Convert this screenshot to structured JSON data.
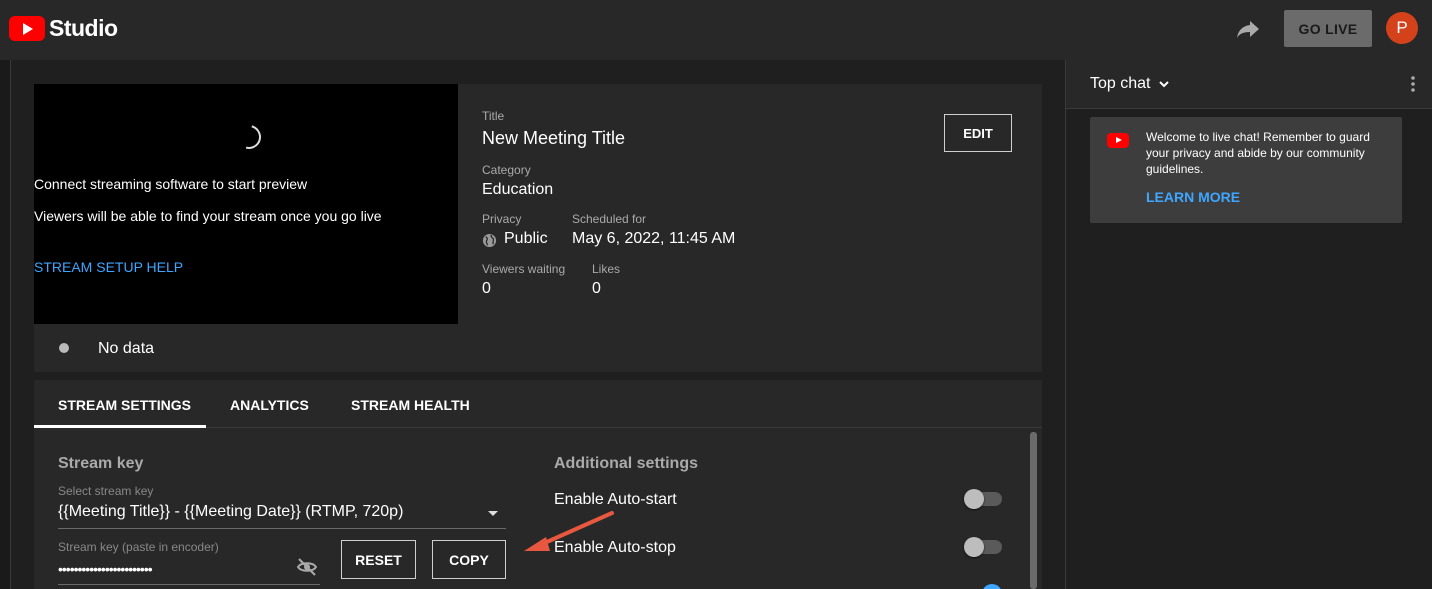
{
  "header": {
    "app_name": "Studio",
    "go_live_label": "GO LIVE",
    "avatar_initial": "P"
  },
  "preview": {
    "message_primary": "Connect streaming software to start preview",
    "message_secondary": "Viewers will be able to find your stream once you go live",
    "setup_help_label": "STREAM SETUP HELP"
  },
  "details": {
    "title_label": "Title",
    "title_value": "New Meeting Title",
    "category_label": "Category",
    "category_value": "Education",
    "privacy_label": "Privacy",
    "privacy_value": "Public",
    "scheduled_label": "Scheduled for",
    "scheduled_value": "May 6, 2022, 11:45 AM",
    "viewers_label": "Viewers waiting",
    "viewers_value": "0",
    "likes_label": "Likes",
    "likes_value": "0",
    "edit_label": "EDIT"
  },
  "status": {
    "text": "No data"
  },
  "tabs": [
    {
      "label": "STREAM SETTINGS",
      "active": true
    },
    {
      "label": "ANALYTICS",
      "active": false
    },
    {
      "label": "STREAM HEALTH",
      "active": false
    }
  ],
  "stream_key": {
    "section_title": "Stream key",
    "select_label": "Select stream key",
    "select_value": "{{Meeting Title}} - {{Meeting Date}} (RTMP, 720p)",
    "key_label": "Stream key (paste in encoder)",
    "key_value": "••••••••••••••••••••••••",
    "reset_label": "RESET",
    "copy_label": "COPY"
  },
  "additional": {
    "section_title": "Additional settings",
    "auto_start_label": "Enable Auto-start",
    "auto_start_on": false,
    "auto_stop_label": "Enable Auto-stop",
    "auto_stop_on": false
  },
  "chat": {
    "title": "Top chat",
    "welcome": "Welcome to live chat! Remember to guard your privacy and abide by our community guidelines.",
    "learn_more_label": "LEARN MORE"
  },
  "colors": {
    "accent_blue": "#3ea6ff",
    "youtube_red": "#ff0000",
    "avatar": "#d4421c",
    "arrow": "#e8573f"
  }
}
